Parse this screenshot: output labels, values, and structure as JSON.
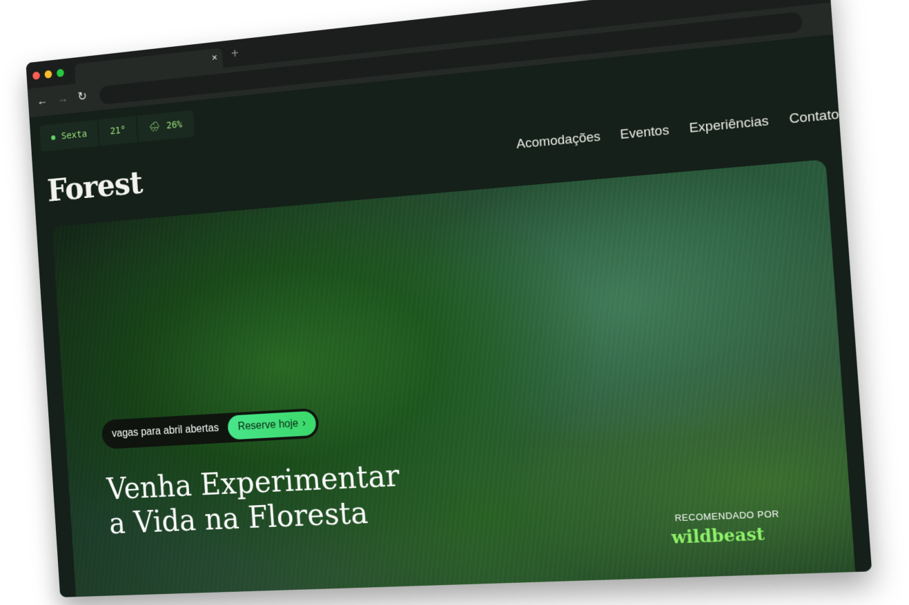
{
  "browser": {
    "tab_close": "×",
    "new_tab": "+",
    "menu_glyph": "⋮",
    "back_glyph": "←",
    "forward_glyph": "→",
    "reload_glyph": "↻",
    "traffic_colors": [
      "#ff5f57",
      "#febc2e",
      "#28c840"
    ]
  },
  "weather": {
    "day": "Sexta",
    "temperature": "21°",
    "rain_icon": "🌧",
    "rain_chance": "26%"
  },
  "site": {
    "logo": "Forest",
    "nav": [
      "Acomodações",
      "Eventos",
      "Experiências",
      "Contato"
    ]
  },
  "hero": {
    "announcement": "vagas para abril abertas",
    "cta_label": "Reserve hoje",
    "cta_chevron": "›",
    "headline_line1": "Venha Experimentar",
    "headline_line2": "a Vida na Floresta",
    "recommended_label": "RECOMENDADO POR",
    "recommended_brand": "wildbeast"
  },
  "colors": {
    "page_bg": "#142019",
    "accent_green": "#3bd96a",
    "weather_text": "#9be07a"
  }
}
